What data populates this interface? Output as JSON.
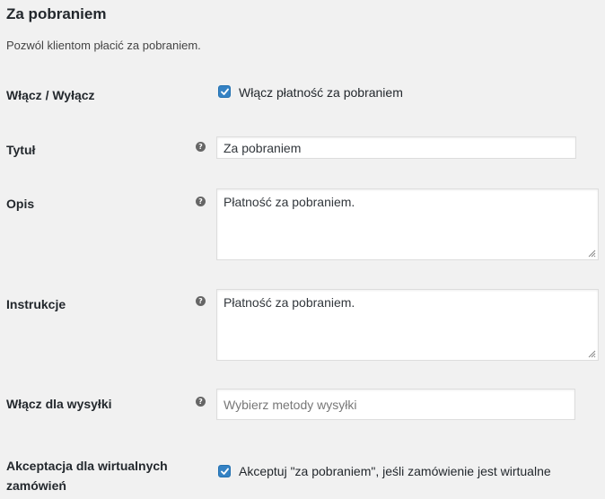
{
  "section": {
    "title": "Za pobraniem",
    "description": "Pozwól klientom płacić za pobraniem."
  },
  "fields": {
    "enable": {
      "label": "Włącz / Wyłącz",
      "checkbox_label": "Włącz płatność za pobraniem",
      "checked": true
    },
    "title": {
      "label": "Tytuł",
      "value": "Za pobraniem",
      "help_icon": "question-mark"
    },
    "description": {
      "label": "Opis",
      "value": "Płatność za pobraniem.",
      "help_icon": "question-mark"
    },
    "instructions": {
      "label": "Instrukcje",
      "value": "Płatność za pobraniem.",
      "help_icon": "question-mark"
    },
    "shipping": {
      "label": "Włącz dla wysyłki",
      "placeholder": "Wybierz metody wysyłki",
      "help_icon": "question-mark"
    },
    "virtual": {
      "label_line1": "Akceptacja dla wirtualnych",
      "label_line2": "zamówień",
      "checkbox_label": "Akceptuj \"za pobraniem\", jeśli zamówienie jest wirtualne",
      "checked": true
    }
  },
  "colors": {
    "accent": "#3582c4",
    "background": "#f1f1f1",
    "help_icon": "#666666"
  }
}
